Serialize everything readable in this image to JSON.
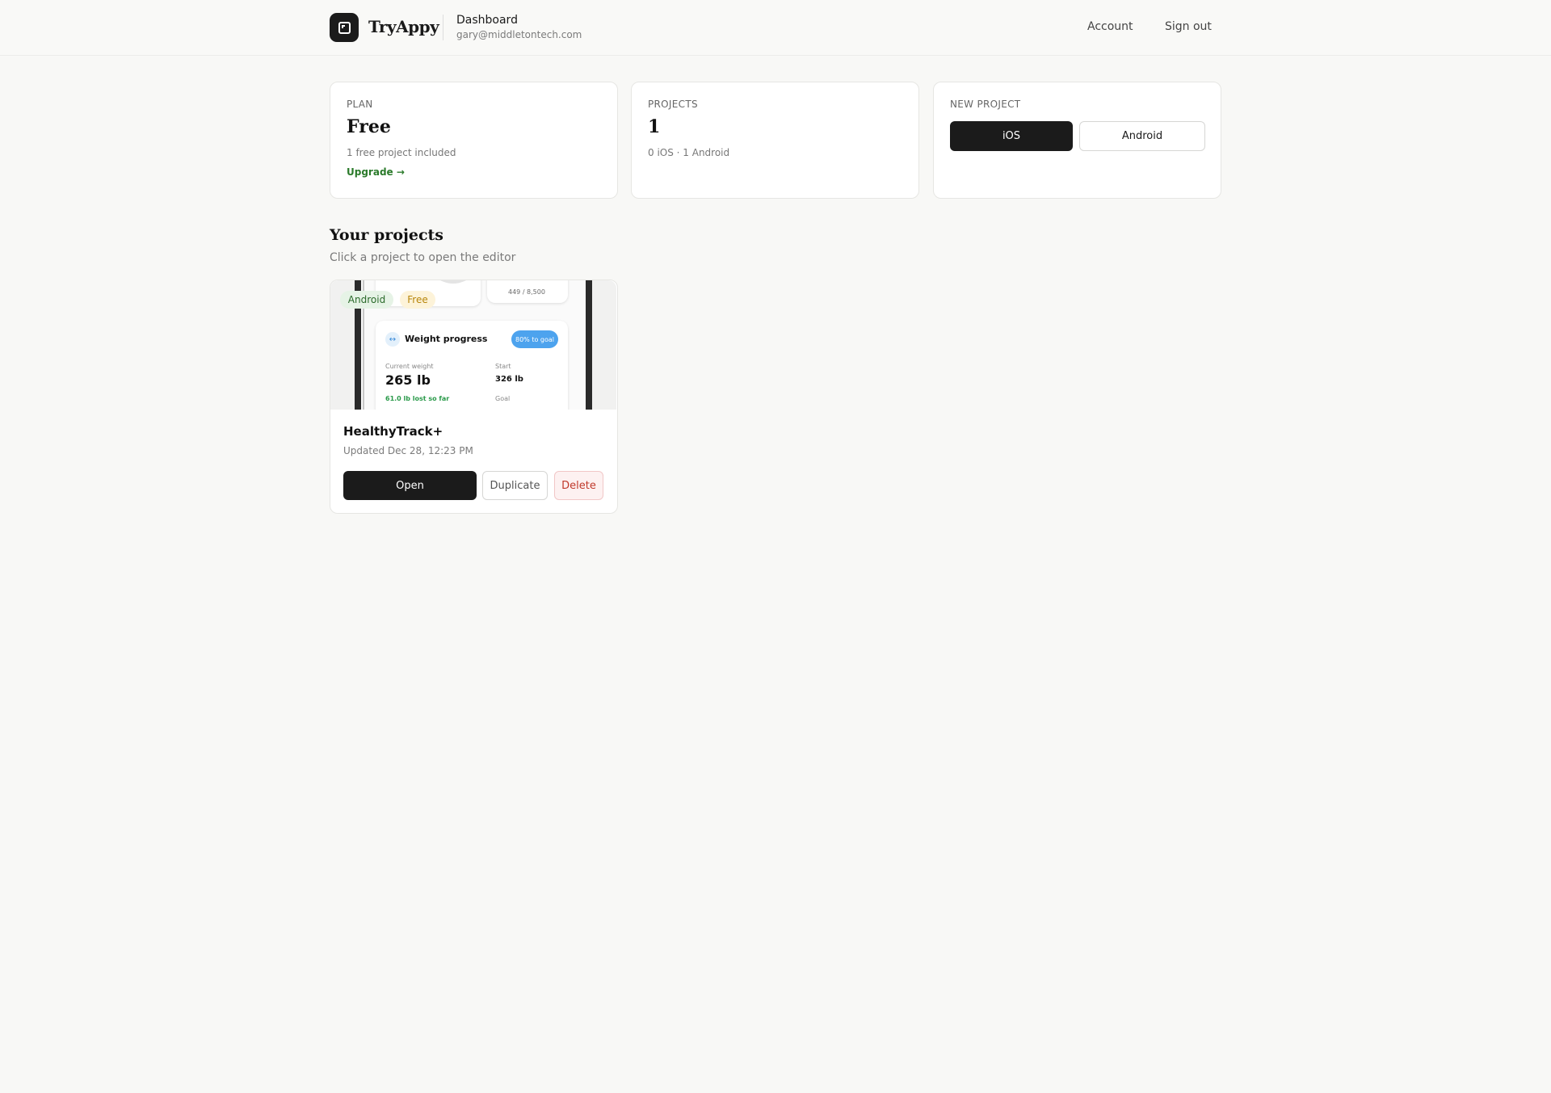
{
  "header": {
    "brand": "TryAppy",
    "title": "Dashboard",
    "email": "gary@middletontech.com",
    "nav": {
      "account": "Account",
      "sign_out": "Sign out"
    }
  },
  "stats": {
    "plan": {
      "label": "PLAN",
      "value": "Free",
      "sub": "1 free project included",
      "link": "Upgrade →"
    },
    "projects": {
      "label": "PROJECTS",
      "value": "1",
      "sub": "0 iOS · 1 Android"
    },
    "new_project": {
      "label": "NEW PROJECT",
      "ios": "iOS",
      "android": "Android"
    }
  },
  "section": {
    "title": "Your projects",
    "subtitle": "Click a project to open the editor"
  },
  "project": {
    "name": "HealthyTrack+",
    "updated": "Updated Dec 28, 12:23 PM",
    "badges": {
      "platform": "Android",
      "tier": "Free"
    },
    "actions": {
      "open": "Open",
      "duplicate": "Duplicate",
      "delete": "Delete"
    },
    "preview": {
      "steps": "449 / 8,500",
      "steps_progress": 0.05,
      "card_title": "Weight progress",
      "goal_badge": "80% to goal",
      "current_label": "Current weight",
      "current_value": "265 lb",
      "lost": "61.0 lb lost so far",
      "start_label": "Start",
      "start_value": "326 lb",
      "goal_label": "Goal"
    }
  },
  "colors": {
    "accent_dark": "#1b1b1b",
    "upgrade_green": "#2a7a2a",
    "android_badge": "#e6f3e6",
    "free_badge": "#fdf3d9",
    "danger": "#c0392b",
    "goal_blue": "#4da3ee"
  }
}
